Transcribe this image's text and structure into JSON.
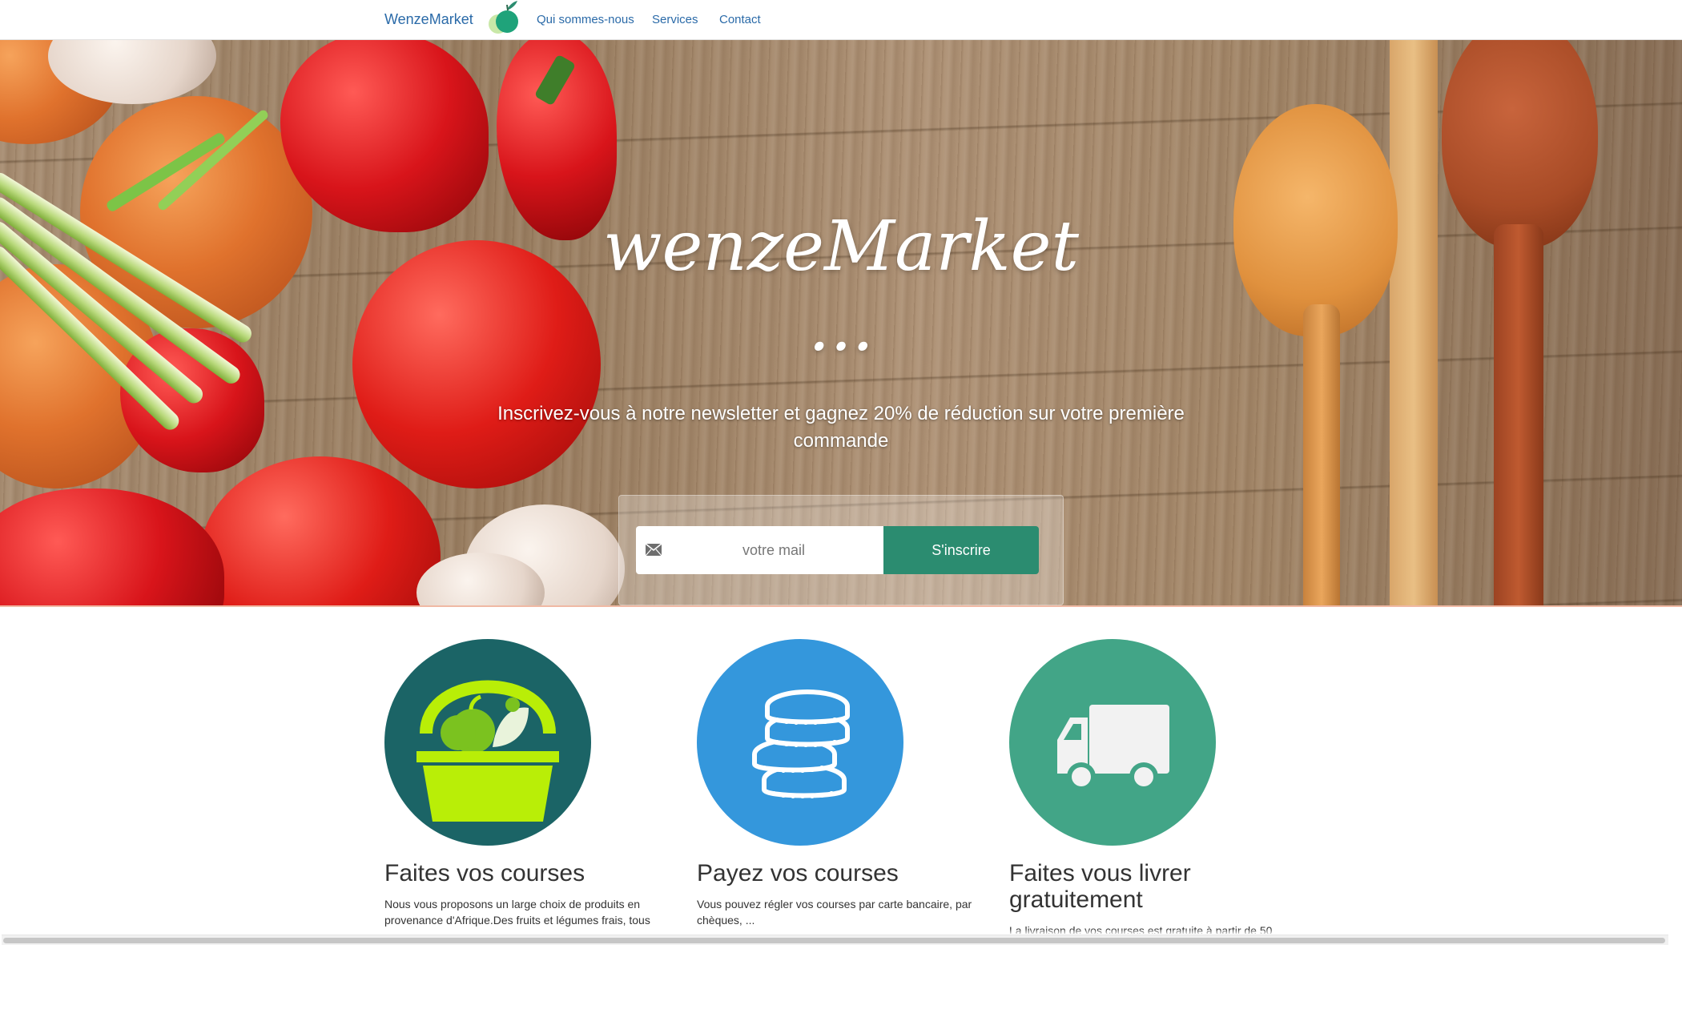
{
  "navbar": {
    "brand": "WenzeMarket",
    "links": [
      "Qui sommes-nous",
      "Services",
      "Contact"
    ],
    "link_color": "#2a6aa8"
  },
  "hero": {
    "title": "wenzeMarket ...",
    "subtitle": "Inscrivez-vous à notre newsletter et gagnez 20% de réduction sur votre première commande",
    "signup": {
      "placeholder": "votre mail",
      "button_label": "S'inscrire",
      "button_color": "#2b8c70",
      "icon": "envelope-icon"
    }
  },
  "features": [
    {
      "icon": "basket-icon",
      "circle_color": "#1b6466",
      "title": "Faites vos courses",
      "text": "Nous vous proposons un large choix de produits en provenance d'Afrique.Des fruits et légumes frais, tous"
    },
    {
      "icon": "coins-icon",
      "circle_color": "#3497dc",
      "title": "Payez vos courses",
      "text": "Vous pouvez régler vos courses par carte bancaire, par chèques, ..."
    },
    {
      "icon": "truck-icon",
      "circle_color": "#42a587",
      "title": "Faites vous livrer gratuitement",
      "text": "La livraison de vos courses est gratuite à partir de 50"
    }
  ]
}
